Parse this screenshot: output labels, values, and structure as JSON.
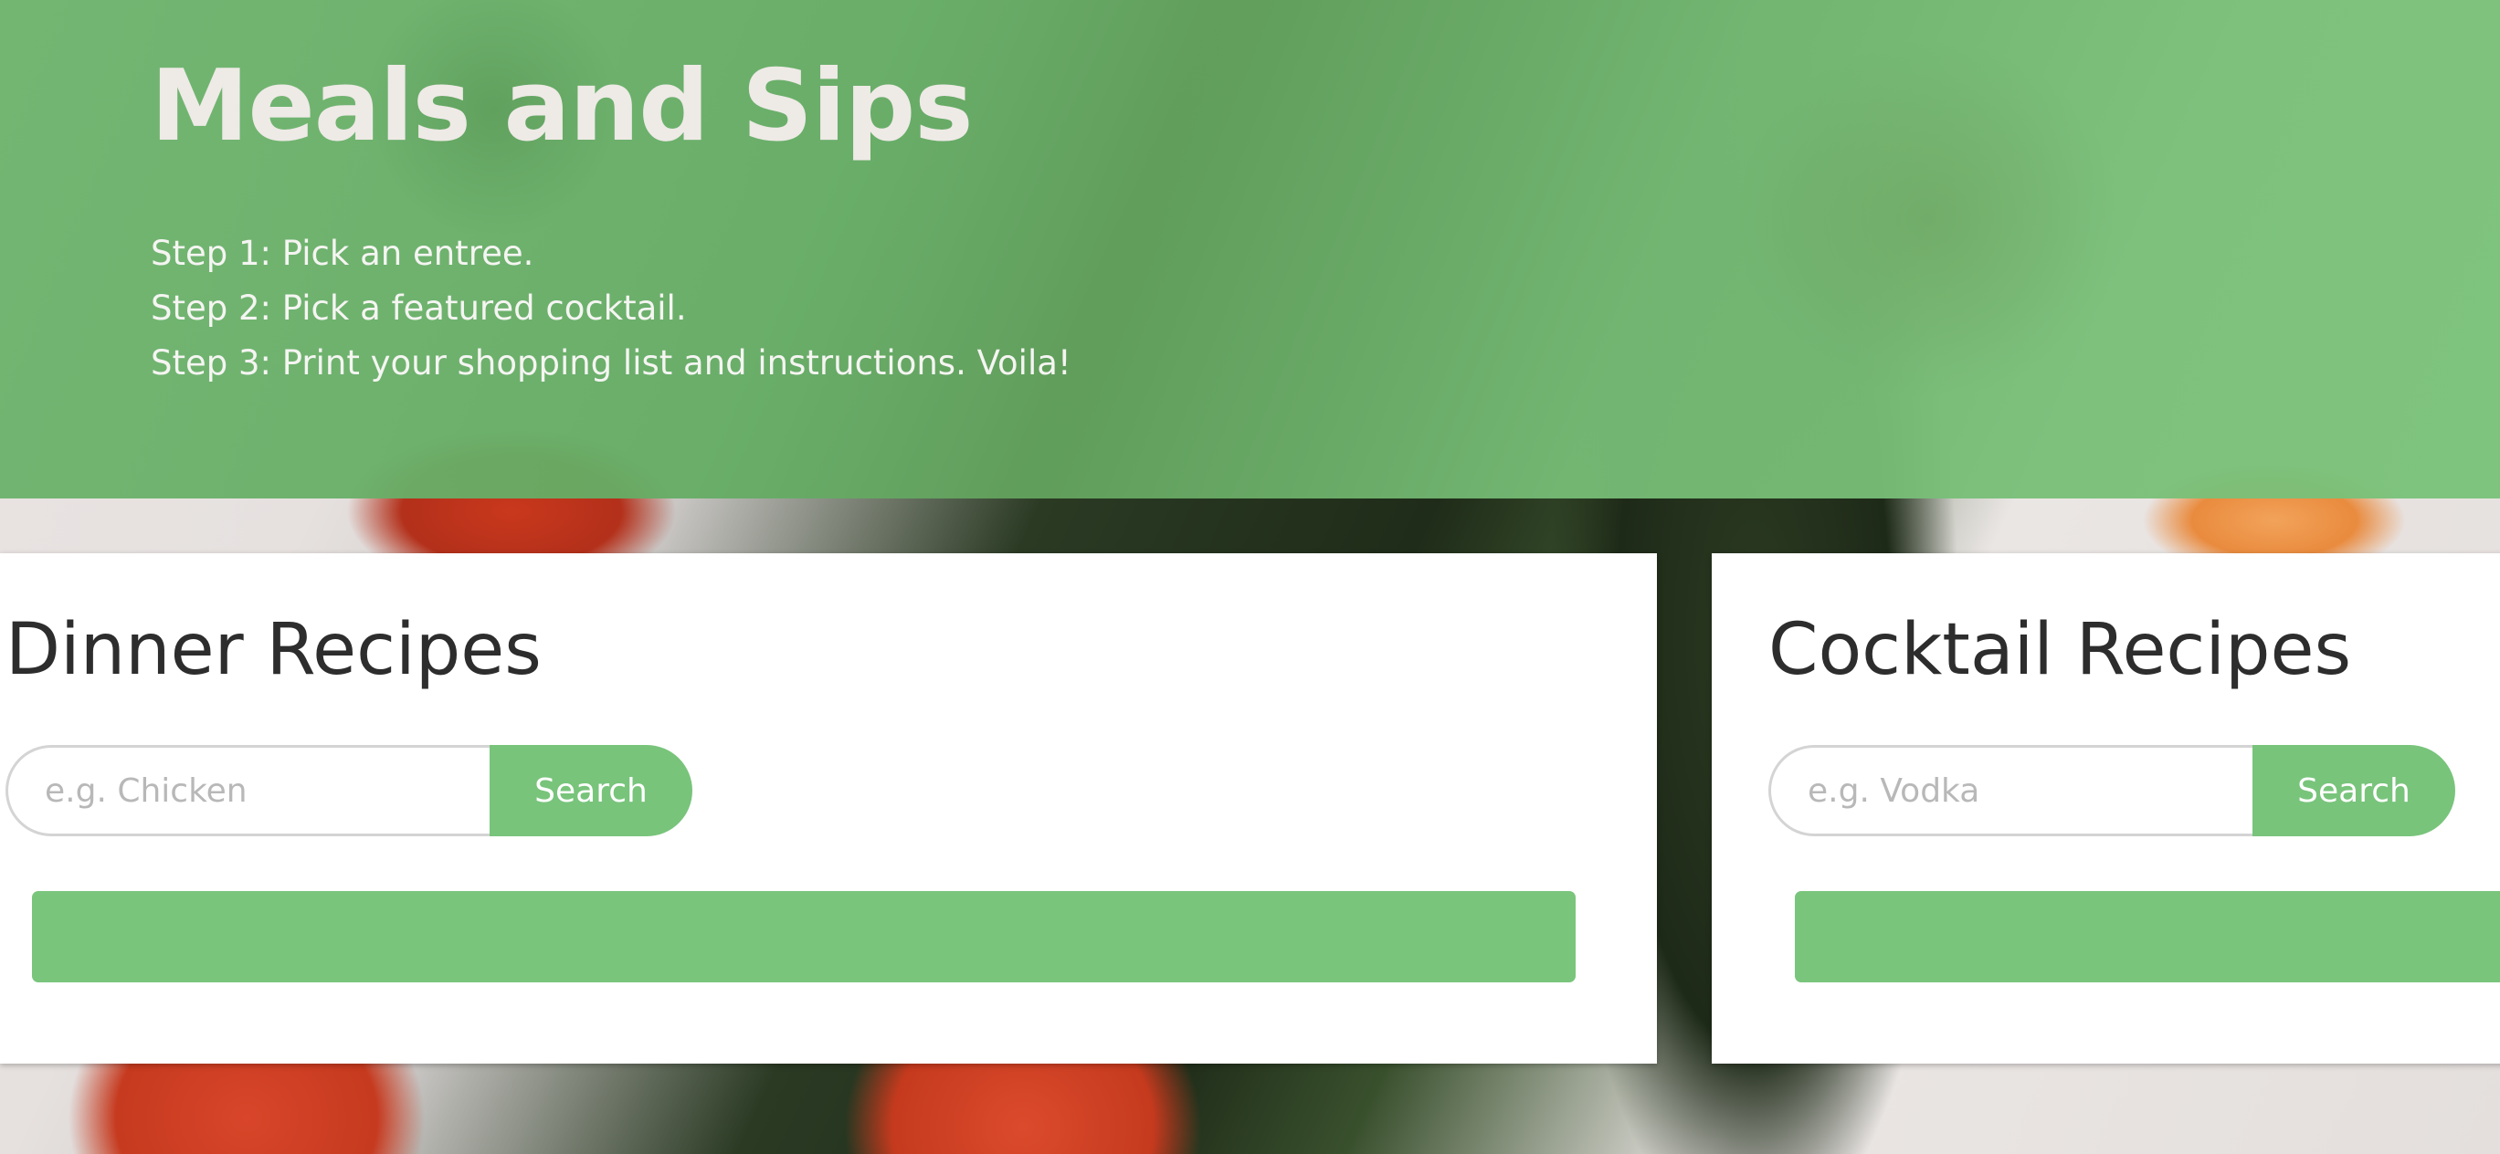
{
  "hero": {
    "title": "Meals and Sips",
    "steps": [
      "Step 1: Pick an entree.",
      "Step 2: Pick a featured cocktail.",
      "Step 3: Print your shopping list and instructions. Voila!"
    ]
  },
  "dinner": {
    "title": "Dinner Recipes",
    "search_placeholder": "e.g. Chicken",
    "search_value": "",
    "search_button": "Search"
  },
  "cocktail": {
    "title": "Cocktail Recipes",
    "search_placeholder": "e.g. Vodka",
    "search_value": "",
    "search_button": "Search"
  },
  "colors": {
    "accent": "#78c47b",
    "title_text": "#2d2d2d",
    "hero_title": "#eeeae6"
  }
}
